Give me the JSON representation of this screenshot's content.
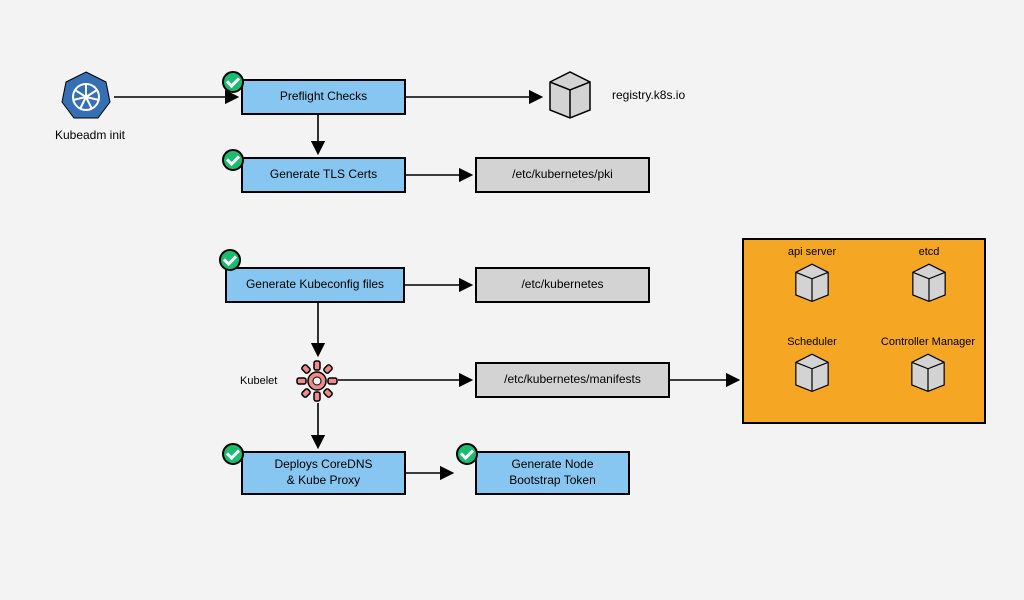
{
  "start": {
    "label": "Kubeadm init"
  },
  "steps": {
    "preflight": "Preflight Checks",
    "tls": "Generate TLS Certs",
    "kubeconfig": "Generate Kubeconfig files",
    "kubelet": "Kubelet",
    "coredns": "Deploys CoreDNS\n& Kube Proxy",
    "bootstrap": "Generate Node\nBootstrap Token"
  },
  "outputs": {
    "registry": "registry.k8s.io",
    "pki": "/etc/kubernetes/pki",
    "etc_k8s": "/etc/kubernetes",
    "manifests": "/etc/kubernetes/manifests"
  },
  "components": {
    "api": "api server",
    "etcd": "etcd",
    "scheduler": "Scheduler",
    "cm": "Controller Manager"
  }
}
